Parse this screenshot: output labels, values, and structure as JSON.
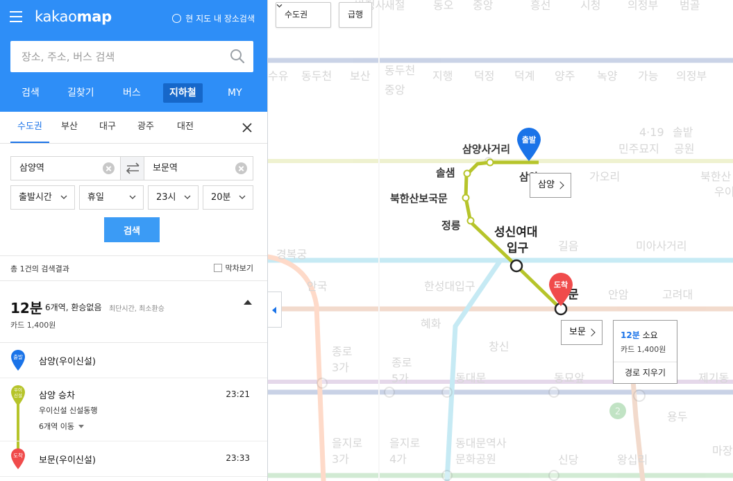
{
  "app": {
    "logo_light": "kakao",
    "logo_bold": "map",
    "area_search_label": "현 지도 내 장소검색"
  },
  "search": {
    "placeholder": "장소, 주소, 버스 검색"
  },
  "main_tabs": [
    {
      "label": "검색",
      "active": false
    },
    {
      "label": "길찾기",
      "active": false
    },
    {
      "label": "버스",
      "active": false
    },
    {
      "label": "지하철",
      "active": true
    },
    {
      "label": "MY",
      "active": false
    }
  ],
  "region_tabs": [
    {
      "label": "수도권",
      "active": true
    },
    {
      "label": "부산",
      "active": false
    },
    {
      "label": "대구",
      "active": false
    },
    {
      "label": "광주",
      "active": false
    },
    {
      "label": "대전",
      "active": false
    }
  ],
  "route_form": {
    "origin": "삼양역",
    "destination": "보문역",
    "time_type": "출발시간",
    "day": "휴일",
    "hour": "23시",
    "minute": "20분",
    "search_button": "검색"
  },
  "results": {
    "count_label": "총 1건의 검색결과",
    "last_train_label": "막차보기"
  },
  "route": {
    "duration": "12분",
    "summary": "6개역, 환승없음",
    "tags": "최단시간, 최소환승",
    "fare": "카드 1,400원",
    "steps": {
      "start_badge": "출발",
      "start_name": "삼양(우이신설)",
      "line_badge": "우이\n신설",
      "board_name": "삼양 승차",
      "board_time": "23:21",
      "line_direction": "우이신설 신설동행",
      "move_label": "6개역 이동",
      "end_badge": "도착",
      "end_name": "보문(우이신설)",
      "end_time": "23:33"
    }
  },
  "map": {
    "region_select": "수도권",
    "express_button": "급행",
    "start_pin": "출발",
    "end_pin": "도착",
    "origin_chip": "삼양",
    "dest_chip": "보문",
    "info_duration": "12분",
    "info_duration_suffix": "소요",
    "info_fare": "카드 1,400원",
    "clear_route": "경로 지우기",
    "route_stations": [
      {
        "name": "삼양사거리"
      },
      {
        "name": "솔샘"
      },
      {
        "name": "북한산보국문"
      },
      {
        "name": "정릉"
      },
      {
        "name": "성신여대"
      },
      {
        "name": "입구"
      },
      {
        "name": "삼양"
      },
      {
        "name": "문"
      }
    ],
    "faded_labels": [
      "수유",
      "동두천",
      "보산",
      "동두천",
      "중앙",
      "지행",
      "덕정",
      "덕계",
      "양주",
      "녹양",
      "가능",
      "의정부",
      "가오리",
      "4·19",
      "민주묘지",
      "솔밭",
      "공원",
      "북한산",
      "우이",
      "길음",
      "미아사거리",
      "안암",
      "고려대",
      "경복궁",
      "안국",
      "한성대입구",
      "혜화",
      "창신",
      "종로",
      "3가",
      "종로",
      "5가",
      "동대문",
      "동묘앞",
      "제기동",
      "용두",
      "을지로",
      "3가",
      "을지로",
      "4가",
      "동대문역사",
      "문화공원",
      "신당",
      "왕십리",
      "마장",
      "새절",
      "동오",
      "중앙",
      "흥선",
      "시청",
      "의정부",
      "범골",
      "반정사"
    ],
    "line_colors": {
      "ui_sinseol": "#b6c42a",
      "line1": "#0d3692",
      "line2": "#33a23d",
      "line3": "#fe5d10",
      "line4": "#00a2d1",
      "line5": "#8b50a4",
      "line6": "#c55c1d"
    },
    "pin_colors": {
      "start": "#1a73e8",
      "end": "#f04b4b"
    }
  }
}
